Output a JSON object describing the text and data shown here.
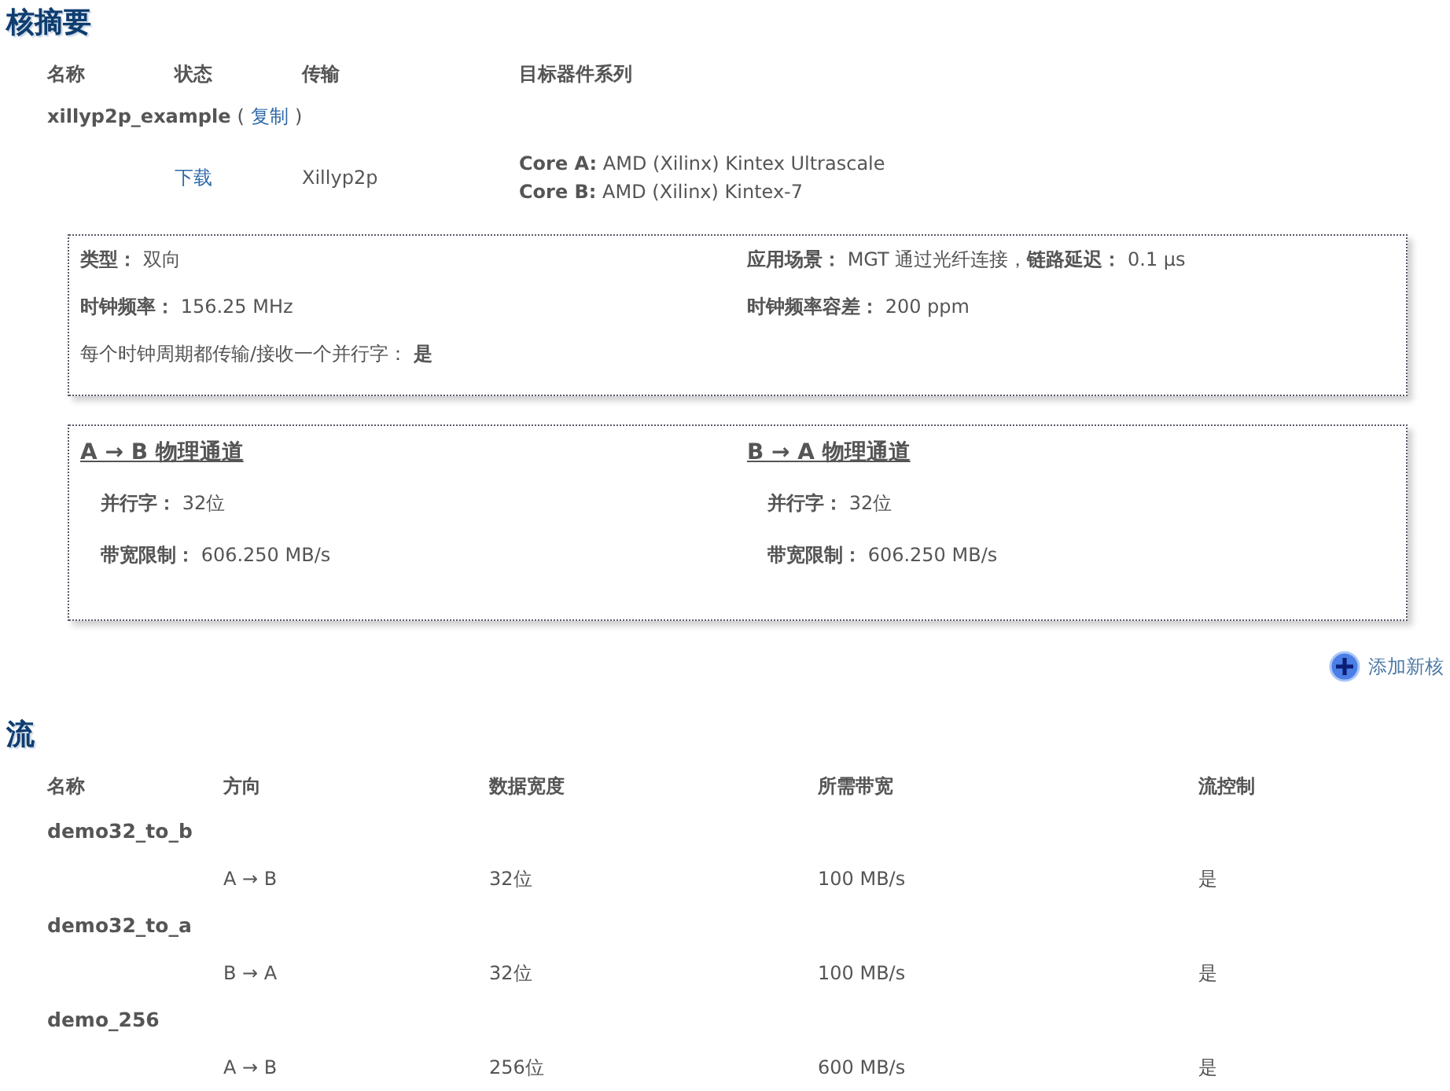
{
  "core_summary": {
    "title": "核摘要",
    "columns": [
      "名称",
      "状态",
      "传输",
      "目标器件系列"
    ],
    "core": {
      "name": "xillyp2p_example",
      "open_paren": "(",
      "copy_link": "复制",
      "close_paren": ")",
      "status_link": "下载",
      "transport": "Xillyp2p",
      "targets": [
        "**Core A:** AMD (Xilinx) Kintex Ultrascale",
        "**Core B:** AMD (Xilinx) Kintex-7"
      ]
    }
  },
  "properties": [
    "**类型：** 双向",
    "**应用场景：** MGT 通过光纤连接，**链路延迟：** 0.1 μs",
    "**时钟频率：** 156.25 MHz",
    "**时钟频率容差：** 200 ppm",
    "每个时钟周期都传输/接收一个并行字： **是**"
  ],
  "channels": [
    {
      "title": "A → B 物理通道",
      "items": [
        "**并行字：** 32位",
        "**带宽限制：** 606.250 MB/s"
      ]
    },
    {
      "title": "B → A 物理通道",
      "items": [
        "**并行字：** 32位",
        "**带宽限制：** 606.250 MB/s"
      ]
    }
  ],
  "add_core": {
    "label": "添加新核"
  },
  "streams": {
    "title": "流",
    "columns": [
      "名称",
      "方向",
      "数据宽度",
      "所需带宽",
      "流控制"
    ],
    "rows": [
      {
        "name": "demo32_to_b",
        "direction": "A → B",
        "data_width": "32位",
        "bandwidth": "100 MB/s",
        "flow_control": "是"
      },
      {
        "name": "demo32_to_a",
        "direction": "B → A",
        "data_width": "32位",
        "bandwidth": "100 MB/s",
        "flow_control": "是"
      },
      {
        "name": "demo_256",
        "direction": "A → B",
        "data_width": "256位",
        "bandwidth": "600 MB/s",
        "flow_control": "是"
      }
    ]
  }
}
